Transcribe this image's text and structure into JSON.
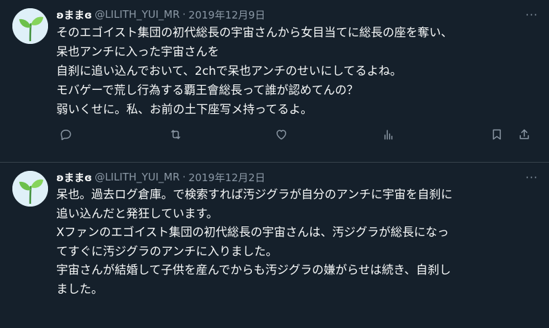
{
  "tweets": [
    {
      "display_name": "ʚままɞ",
      "handle": "@LILITH_YUI_MR",
      "separator": "·",
      "date": "2019年12月9日",
      "text": "そのエゴイスト集団の初代総長の宇宙さんから女目当てに総長の座を奪い、\n呆也アンチに入った宇宙さんを\n自刹に追い込んでおいて、2chで呆也アンチのせいにしてるよね。\nモバゲーで荒し行為する覇王會総長って誰が認めてんの？\n弱いくせに。私、お前の土下座写メ持ってるよ。"
    },
    {
      "display_name": "ʚままɞ",
      "handle": "@LILITH_YUI_MR",
      "separator": "·",
      "date": "2019年12月2日",
      "text": "呆也。過去ログ倉庫。で検索すれば汚ジグラが自分のアンチに宇宙を自刹に\n追い込んだと発狂しています。\nXファンのエゴイスト集団の初代総長の宇宙さんは、汚ジグラが総長になっ\nてすぐに汚ジグラのアンチに入りました。\n宇宙さんが結婚して子供を産んでからも汚ジグラの嫌がらせは続き、自刹し\nました。"
    }
  ],
  "more_label": "···",
  "icons": {
    "reply": "reply-icon",
    "retweet": "retweet-icon",
    "like": "like-icon",
    "views": "views-icon",
    "bookmark": "bookmark-icon",
    "share": "share-icon",
    "more": "more-icon"
  },
  "colors": {
    "background": "#15202b",
    "text": "#f7f9f9",
    "secondary": "#8b98a5",
    "divider": "#38444d"
  }
}
